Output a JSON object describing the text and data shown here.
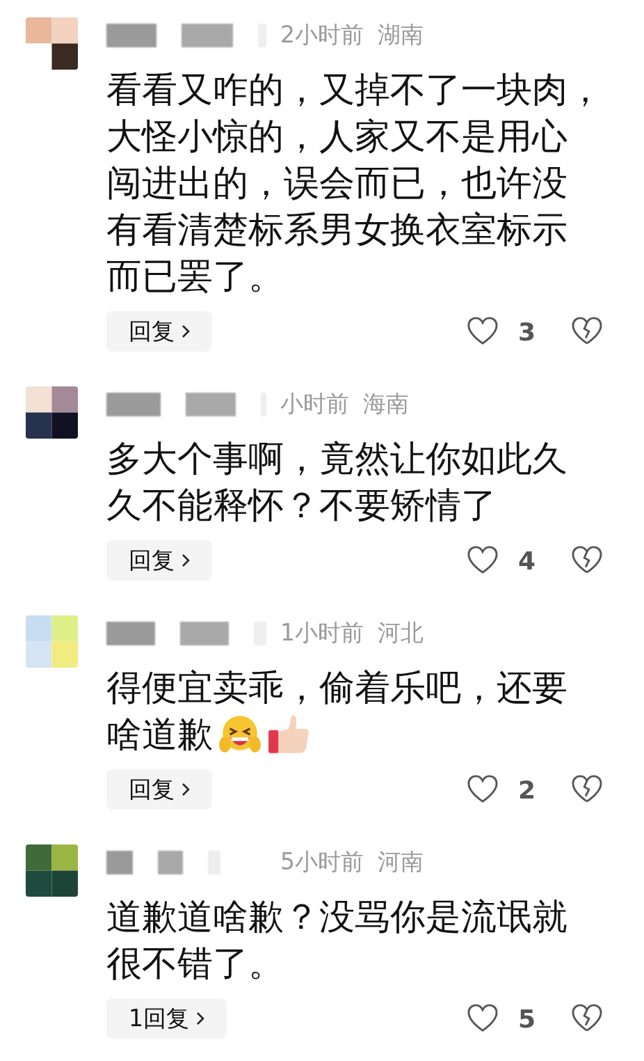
{
  "comments": [
    {
      "time": "2小时前",
      "location": "湖南",
      "lines": [
        "看看又咋的，又掉不了一块肉，",
        "大怪小惊的，人家又不是用心",
        "闯进出的，误会而已，也许没",
        "有看清楚标系男女换衣室标示",
        "而已罢了。"
      ],
      "reply_label": "回复",
      "likes": "3"
    },
    {
      "time": "小时前",
      "location": "海南",
      "lines": [
        "多大个事啊，竟然让你如此久",
        "久不能释怀？不要矫情了"
      ],
      "reply_label": "回复",
      "likes": "4"
    },
    {
      "time": "1小时前",
      "location": "河北",
      "lines": [
        "得便宜卖乖，偷着乐吧，还要",
        "啥道歉"
      ],
      "stickers": [
        {
          "kind": "grin"
        },
        {
          "kind": "thumbs_up"
        }
      ],
      "reply_label": "回复",
      "likes": "2"
    },
    {
      "time": "5小时前",
      "location": "河南",
      "lines": [
        "道歉道啥歉？没骂你是流氓就",
        "很不错了。"
      ],
      "reply_label": "1回复",
      "likes": "5"
    }
  ]
}
